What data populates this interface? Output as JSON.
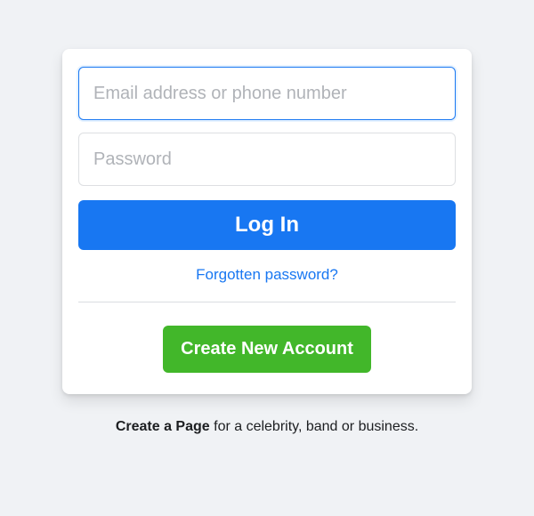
{
  "login": {
    "email_placeholder": "Email address or phone number",
    "password_placeholder": "Password",
    "login_button": "Log In",
    "forgot_password": "Forgotten password?",
    "create_account_button": "Create New Account"
  },
  "footer": {
    "create_page_link": "Create a Page",
    "create_page_suffix": " for a celebrity, band or business."
  }
}
